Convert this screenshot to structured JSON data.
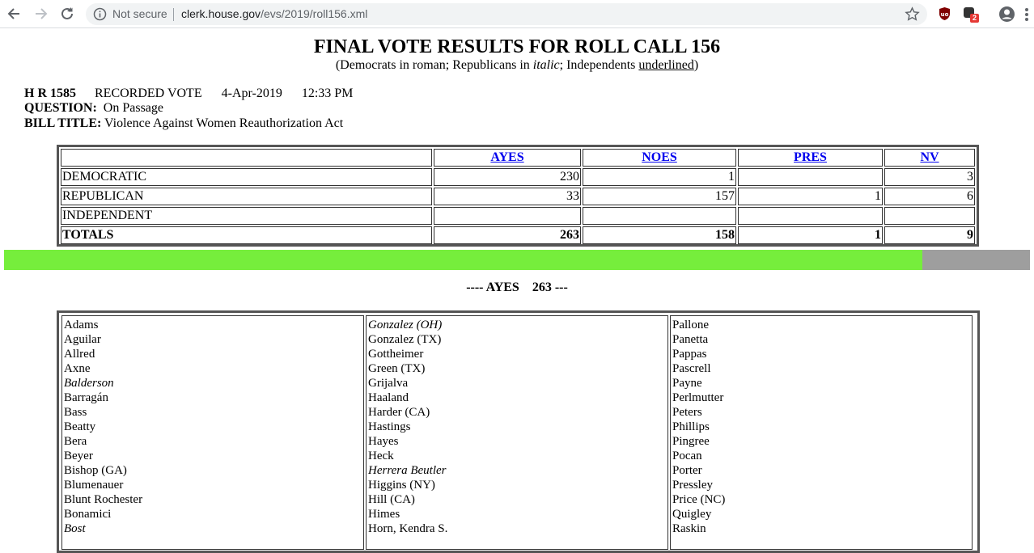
{
  "browser": {
    "security_label": "Not secure",
    "url_host": "clerk.house.gov",
    "url_path": "/evs/2019/roll156.xml",
    "extension_badge": "2"
  },
  "page": {
    "title": "FINAL VOTE RESULTS FOR ROLL CALL 156",
    "legend_pre": "(Democrats in roman; Republicans in ",
    "legend_italic": "italic",
    "legend_mid": "; Independents ",
    "legend_underlined": "underlined",
    "legend_post": ")",
    "bill_number": "H R 1585",
    "vote_type": "RECORDED VOTE",
    "date": "4-Apr-2019",
    "time": "12:33 PM",
    "question_label": "QUESTION:",
    "question": "On Passage",
    "bill_title_label": "BILL TITLE:",
    "bill_title": "Violence Against Women Reauthorization Act"
  },
  "summary": {
    "headers": [
      "AYES",
      "NOES",
      "PRES",
      "NV"
    ],
    "rows": [
      {
        "party": "DEMOCRATIC",
        "ayes": "230",
        "noes": "1",
        "pres": "",
        "nv": "3"
      },
      {
        "party": "REPUBLICAN",
        "ayes": "33",
        "noes": "157",
        "pres": "1",
        "nv": "6"
      },
      {
        "party": "INDEPENDENT",
        "ayes": "",
        "noes": "",
        "pres": "",
        "nv": ""
      },
      {
        "party": "TOTALS",
        "ayes": "263",
        "noes": "158",
        "pres": "1",
        "nv": "9"
      }
    ]
  },
  "vote_bar": {
    "fill_fraction": 0.895,
    "fill_color": "#76ee3c",
    "rest_color": "#9e9e9e"
  },
  "ayes_section": {
    "heading_prefix": "---- AYES",
    "count": "263",
    "heading_suffix": "---"
  },
  "ayes_columns": [
    [
      {
        "name": "Adams",
        "rep": false
      },
      {
        "name": "Aguilar",
        "rep": false
      },
      {
        "name": "Allred",
        "rep": false
      },
      {
        "name": "Axne",
        "rep": false
      },
      {
        "name": "Balderson",
        "rep": true
      },
      {
        "name": "Barragán",
        "rep": false
      },
      {
        "name": "Bass",
        "rep": false
      },
      {
        "name": "Beatty",
        "rep": false
      },
      {
        "name": "Bera",
        "rep": false
      },
      {
        "name": "Beyer",
        "rep": false
      },
      {
        "name": "Bishop (GA)",
        "rep": false
      },
      {
        "name": "Blumenauer",
        "rep": false
      },
      {
        "name": "Blunt Rochester",
        "rep": false
      },
      {
        "name": "Bonamici",
        "rep": false
      },
      {
        "name": "Bost",
        "rep": true
      }
    ],
    [
      {
        "name": "Gonzalez (OH)",
        "rep": true
      },
      {
        "name": "Gonzalez (TX)",
        "rep": false
      },
      {
        "name": "Gottheimer",
        "rep": false
      },
      {
        "name": "Green (TX)",
        "rep": false
      },
      {
        "name": "Grijalva",
        "rep": false
      },
      {
        "name": "Haaland",
        "rep": false
      },
      {
        "name": "Harder (CA)",
        "rep": false
      },
      {
        "name": "Hastings",
        "rep": false
      },
      {
        "name": "Hayes",
        "rep": false
      },
      {
        "name": "Heck",
        "rep": false
      },
      {
        "name": "Herrera Beutler",
        "rep": true
      },
      {
        "name": "Higgins (NY)",
        "rep": false
      },
      {
        "name": "Hill (CA)",
        "rep": false
      },
      {
        "name": "Himes",
        "rep": false
      },
      {
        "name": "Horn, Kendra S.",
        "rep": false
      }
    ],
    [
      {
        "name": "Pallone",
        "rep": false
      },
      {
        "name": "Panetta",
        "rep": false
      },
      {
        "name": "Pappas",
        "rep": false
      },
      {
        "name": "Pascrell",
        "rep": false
      },
      {
        "name": "Payne",
        "rep": false
      },
      {
        "name": "Perlmutter",
        "rep": false
      },
      {
        "name": "Peters",
        "rep": false
      },
      {
        "name": "Phillips",
        "rep": false
      },
      {
        "name": "Pingree",
        "rep": false
      },
      {
        "name": "Pocan",
        "rep": false
      },
      {
        "name": "Porter",
        "rep": false
      },
      {
        "name": "Pressley",
        "rep": false
      },
      {
        "name": "Price (NC)",
        "rep": false
      },
      {
        "name": "Quigley",
        "rep": false
      },
      {
        "name": "Raskin",
        "rep": false
      }
    ]
  ]
}
